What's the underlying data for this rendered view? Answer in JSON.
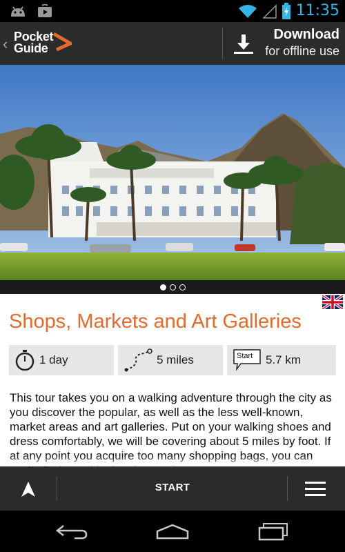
{
  "status_bar": {
    "time": "11:35"
  },
  "action_bar": {
    "logo_line1": "Pocket",
    "logo_line2": "Guide",
    "download_title": "Download",
    "download_subtitle": "for offline use"
  },
  "hero": {
    "pages": 3,
    "active_page": 1
  },
  "tour": {
    "title": "Shops, Markets and Art Galleries",
    "duration": "1 day",
    "distance_miles": "5 miles",
    "start_icon_label": "Start",
    "start_distance": "5.7 km",
    "description": "This tour takes you on a walking adventure through the city as you discover the popular, as well as the less well-known, market areas and art galleries. Put on your walking shoes and dress comfortably, we will be covering about 5 miles by foot. If at any point you acquire too many shopping bags, you can easily find a taxi in the city to take"
  },
  "bottom_bar": {
    "start_label": "START"
  },
  "colors": {
    "accent": "#e46a2e",
    "bar": "#2b2b2b",
    "status_icon": "#33b5e5"
  }
}
